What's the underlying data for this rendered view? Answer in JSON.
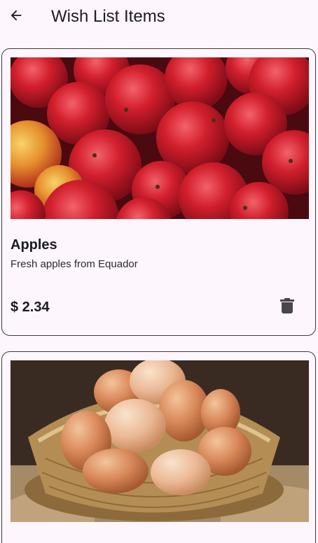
{
  "app_bar": {
    "back_icon": "arrow-back-icon",
    "title": "Wish List Items"
  },
  "items": [
    {
      "title": "Apples",
      "description": "Fresh apples from Equador",
      "price": "$ 2.34",
      "image": "apples-photo",
      "delete_icon": "trash-icon"
    },
    {
      "image": "eggs-in-basket-photo"
    }
  ],
  "colors": {
    "background": "#fdf7fd",
    "text": "#1d1b20",
    "card_border": "#3a3a3a",
    "icon": "#49454f"
  }
}
